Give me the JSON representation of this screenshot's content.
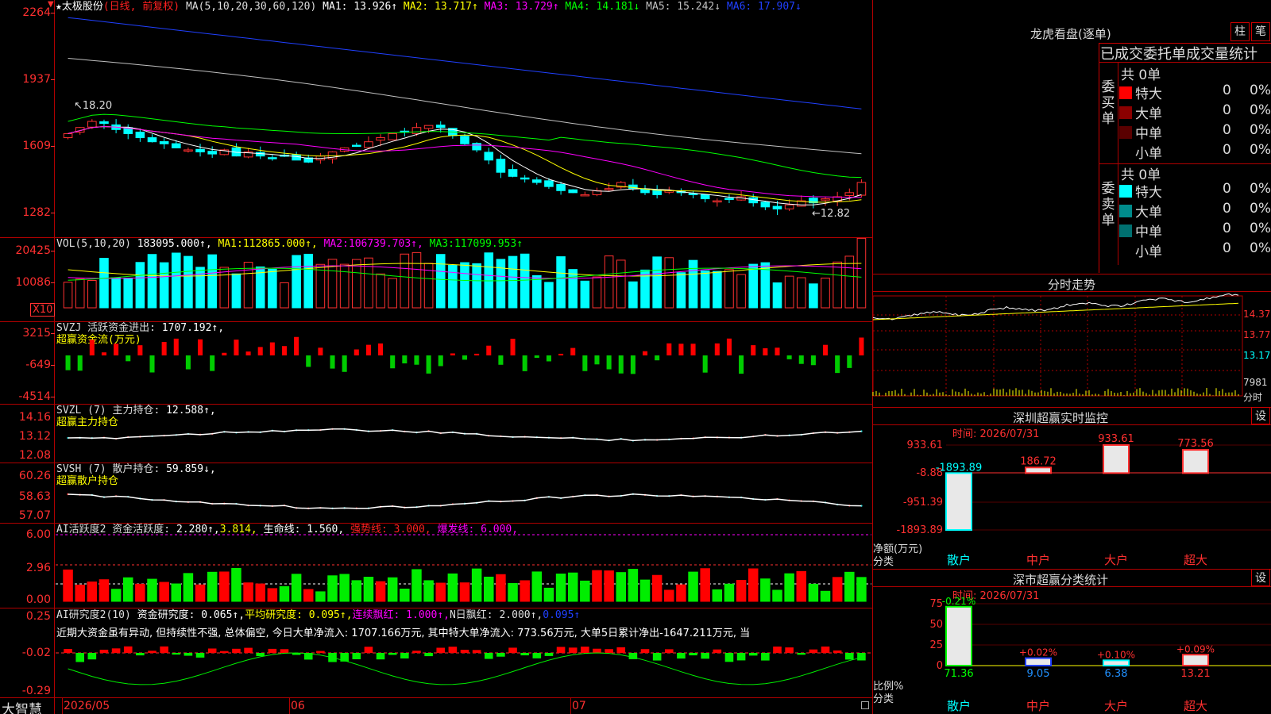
{
  "main": {
    "title_prefix": "★太极股份",
    "title_mode": "(日线, 前复权)",
    "ma_label": "MA(5,10,20,30,60,120)",
    "mas": [
      {
        "label": "MA1:",
        "value": "13.926↑",
        "color": "#ffffff"
      },
      {
        "label": "MA2:",
        "value": "13.717↑",
        "color": "#ffff00"
      },
      {
        "label": "MA3:",
        "value": "13.729↑",
        "color": "#ff00ff"
      },
      {
        "label": "MA4:",
        "value": "14.181↓",
        "color": "#00ff00"
      },
      {
        "label": "MA5:",
        "value": "15.242↓",
        "color": "#c0c0c0"
      },
      {
        "label": "MA6:",
        "value": "17.907↓",
        "color": "#2040ff"
      }
    ],
    "axis": [
      "2264",
      "1937",
      "1609",
      "1282"
    ],
    "high_marker": "18.20",
    "low_marker": "12.82",
    "candles": [
      {
        "o": 1.08,
        "c": 1.12
      },
      {
        "o": 1.2,
        "c": 1.28
      },
      {
        "o": 1.32,
        "c": 1.38
      },
      {
        "o": 1.34,
        "c": 1.26
      },
      {
        "o": 1.36,
        "c": 1.28
      },
      {
        "o": 1.28,
        "c": 1.42
      },
      {
        "o": 1.16,
        "c": 1.22
      },
      {
        "o": 1.5,
        "c": 1.58
      },
      {
        "o": 1.62,
        "c": 1.68
      },
      {
        "o": 1.72,
        "c": 1.66
      },
      {
        "o": 1.52,
        "c": 1.4
      },
      {
        "o": 1.44,
        "c": 1.38
      },
      {
        "o": 1.4,
        "c": 1.26
      },
      {
        "o": 1.34,
        "c": 1.22
      },
      {
        "o": 1.14,
        "c": 1.2
      },
      {
        "o": 1.18,
        "c": 1.22
      },
      {
        "o": 1.06,
        "c": 1.1
      },
      {
        "o": 0.88,
        "c": 0.92
      },
      {
        "o": 0.76,
        "c": 0.8
      },
      {
        "o": 0.74,
        "c": 0.72
      },
      {
        "o": 0.68,
        "c": 0.64
      },
      {
        "o": 0.56,
        "c": 0.5
      },
      {
        "o": 0.46,
        "c": 0.4
      },
      {
        "o": 0.32,
        "c": 0.26
      },
      {
        "o": 0.2,
        "c": 0.14
      },
      {
        "o": 0.04,
        "c": -0.1
      },
      {
        "o": -0.02,
        "c": -0.1
      },
      {
        "o": -0.22,
        "c": -0.16
      },
      {
        "o": -0.3,
        "c": -0.22
      },
      {
        "o": -0.36,
        "c": -0.24
      },
      {
        "o": -0.42,
        "c": -0.28
      },
      {
        "o": -0.48,
        "c": -0.4
      },
      {
        "o": -0.54,
        "c": -0.46
      },
      {
        "o": -0.56,
        "c": -0.5
      },
      {
        "o": -0.6,
        "c": -0.52
      },
      {
        "o": -0.62,
        "c": -0.54
      },
      {
        "o": -0.64,
        "c": -0.58
      },
      {
        "o": -0.64,
        "c": -0.58
      },
      {
        "o": -0.62,
        "c": -0.56
      },
      {
        "o": -0.6,
        "c": -0.52
      },
      {
        "o": -0.56,
        "c": -0.48
      },
      {
        "o": -0.5,
        "c": -0.4
      },
      {
        "o": -0.4,
        "c": -0.3
      },
      {
        "o": -0.3,
        "c": -0.22
      },
      {
        "o": -0.2,
        "c": -0.12
      },
      {
        "o": -0.1,
        "c": 0.0
      },
      {
        "o": 0.0,
        "c": 0.12
      },
      {
        "o": 0.14,
        "c": 0.2
      },
      {
        "o": 0.2,
        "c": 0.28
      },
      {
        "o": 0.3,
        "c": 0.34
      },
      {
        "o": 0.34,
        "c": 0.4
      },
      {
        "o": 0.4,
        "c": 0.46
      },
      {
        "o": 0.44,
        "c": 0.5
      },
      {
        "o": 0.48,
        "c": 0.56
      },
      {
        "o": 0.52,
        "c": 0.58
      },
      {
        "o": 0.56,
        "c": 0.62
      },
      {
        "o": 0.58,
        "c": 0.66
      },
      {
        "o": 0.62,
        "c": 0.7
      },
      {
        "o": 0.68,
        "c": 0.76
      },
      {
        "o": 0.74,
        "c": 0.8
      },
      {
        "o": 0.8,
        "c": 0.9
      },
      {
        "o": 0.9,
        "c": 0.96
      },
      {
        "o": 0.96,
        "c": 1.04
      },
      {
        "o": 1.04,
        "c": 1.12
      },
      {
        "o": 1.1,
        "c": 1.18
      },
      {
        "o": 1.2,
        "c": 1.34
      },
      {
        "o": 1.36,
        "c": 1.48
      }
    ]
  },
  "vol": {
    "title": "VOL(5,10,20)",
    "value": "183095.000↑,",
    "ma1_label": "MA1:",
    "ma1": "112865.000↑,",
    "ma2_label": "MA2:",
    "ma2": "106739.703↑,",
    "ma3_label": "MA3:",
    "ma3": "117099.953↑",
    "axis": [
      "20425",
      "10086"
    ],
    "unit": "X10"
  },
  "svzj": {
    "title": "SVZJ  活跃资金进出:",
    "value": "1707.192↑,",
    "subtitle": "超赢资金流(万元)",
    "axis": [
      "3215",
      "-649",
      "-4514"
    ]
  },
  "svzl": {
    "title": "SVZL (7) 主力持仓:",
    "value": "12.588↑,",
    "subtitle": "超赢主力持仓",
    "axis": [
      "14.16",
      "13.12",
      "12.08"
    ]
  },
  "svsh": {
    "title": "SVSH (7) 散户持仓:",
    "value": "59.859↓,",
    "subtitle": "超赢散户持仓",
    "axis": [
      "60.26",
      "58.63",
      "57.07"
    ]
  },
  "ai_active": {
    "title": "AI活跃度2 资金活跃度:",
    "v1": "2.280↑,",
    "v2": "3.814,",
    "life": "生命线: 1.560,",
    "strong": "强势线: 3.000,",
    "burst": "爆发线: 6.000,",
    "axis": [
      "6.00",
      "2.96",
      "0.00"
    ]
  },
  "ai_research": {
    "title": "AI研究度2(10)",
    "a": "资金研究度: 0.065↑,",
    "b": "平均研究度: 0.095↑,",
    "c": "连续飘红: 1.000↑,",
    "d": "N日飘红: 2.000↑,",
    "e": "0.095↑",
    "comment": "近期大资金虽有异动, 但持续性不强, 总体偏空, 今日大单净流入: 1707.166万元, 其中特大单净流入: 773.56万元, 大单5日累计净出-1647.211万元, 当",
    "axis": [
      "0.25",
      "-0.02",
      "-0.29"
    ]
  },
  "bottom": {
    "brand": "大智慧",
    "dates": [
      "2026/05",
      "06",
      "07"
    ]
  },
  "dragon": {
    "title": "龙虎看盘(逐单)",
    "btn1": "柱",
    "btn2": "笔",
    "header": "已成交委托单成交量统计",
    "buy_group": "委买单",
    "sell_group": "委卖单",
    "buy_total": "共 0单",
    "sell_total": "共 0单",
    "buy_rows": [
      {
        "label": "特大",
        "count": "0",
        "pct": "0%",
        "color": "#ff0000"
      },
      {
        "label": "大单",
        "count": "0",
        "pct": "0%",
        "color": "#8b0000"
      },
      {
        "label": "中单",
        "count": "0",
        "pct": "0%",
        "color": "#5a0000"
      },
      {
        "label": "小单",
        "count": "0",
        "pct": "0%",
        "color": "#000000"
      }
    ],
    "sell_rows": [
      {
        "label": "特大",
        "count": "0",
        "pct": "0%",
        "color": "#00ffff"
      },
      {
        "label": "大单",
        "count": "0",
        "pct": "0%",
        "color": "#008b8b"
      },
      {
        "label": "中单",
        "count": "0",
        "pct": "0%",
        "color": "#007070"
      },
      {
        "label": "小单",
        "count": "0",
        "pct": "0%",
        "color": "#000000"
      }
    ]
  },
  "minute": {
    "title": "分时走势",
    "axis": [
      "14.37",
      "13.77",
      "13.17"
    ],
    "vol_label": "7981",
    "vol_unit": "分时"
  },
  "sz_monitor": {
    "title": "深圳超赢实时监控",
    "btn": "设",
    "time": "时间: 2026/07/31",
    "axis": [
      "933.61",
      "-8.88",
      "-951.39",
      "-1893.89"
    ],
    "ylabel": "净额(万元)",
    "xlabel": "分类",
    "cats": [
      "散户",
      "中户",
      "大户",
      "超大"
    ],
    "values": [
      -1893.89,
      186.72,
      933.61,
      773.56
    ],
    "labels": [
      "-1893.89",
      "186.72",
      "933.61",
      "773.56"
    ]
  },
  "sz_class": {
    "title": "深市超赢分类统计",
    "btn": "设",
    "time": "时间: 2026/07/31",
    "axis": [
      "75",
      "50",
      "25",
      "0"
    ],
    "ylabel": "比例%",
    "xlabel": "分类",
    "cats": [
      "散户",
      "中户",
      "大户",
      "超大"
    ],
    "values": [
      71.36,
      9.05,
      6.38,
      13.21
    ],
    "deltas": [
      "-0.21%",
      "+0.02%",
      "+0.10%",
      "+0.09%"
    ],
    "labels": [
      "71.36",
      "9.05",
      "6.38",
      "13.21"
    ]
  }
}
